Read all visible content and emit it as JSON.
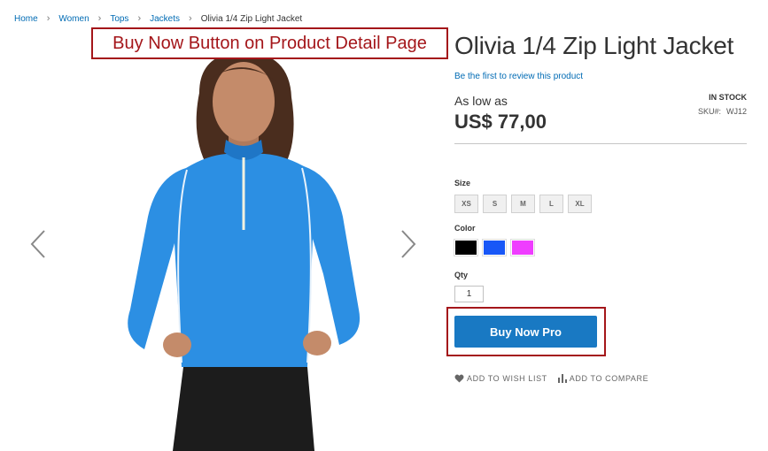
{
  "breadcrumb": {
    "items": [
      "Home",
      "Women",
      "Tops",
      "Jackets"
    ],
    "current": "Olivia 1/4 Zip Light Jacket",
    "separator": "›"
  },
  "annotations": {
    "title_callout": "Buy Now Button on Product Detail Page"
  },
  "product": {
    "title": "Olivia 1/4 Zip Light Jacket",
    "review_link": "Be the first to review this product",
    "price_label": "As low as",
    "price": "US$ 77,00",
    "stock": "IN STOCK",
    "sku_label": "SKU#:",
    "sku": "WJ12",
    "image_icon": "jacket-model-photo"
  },
  "options": {
    "size_label": "Size",
    "sizes": [
      "XS",
      "S",
      "M",
      "L",
      "XL"
    ],
    "color_label": "Color",
    "colors": [
      "#000000",
      "#1857f7",
      "#ef3dff"
    ],
    "qty_label": "Qty",
    "qty_value": "1"
  },
  "buttons": {
    "buy_now": "Buy Now Pro",
    "wishlist": "ADD TO WISH LIST",
    "compare": "ADD TO COMPARE"
  },
  "colors": {
    "accent": "#1979c3",
    "link": "#006bb4",
    "annotation": "#a4161a"
  }
}
